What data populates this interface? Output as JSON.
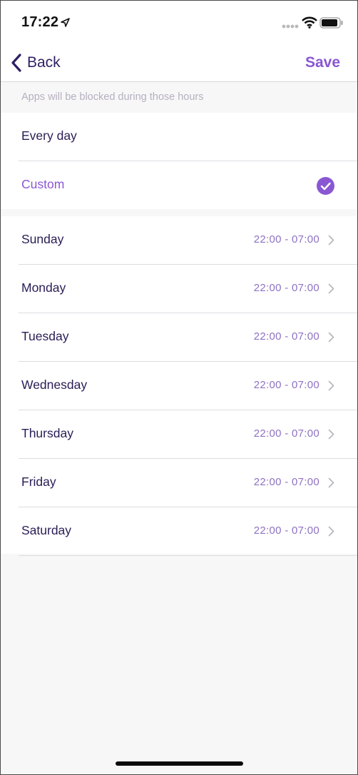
{
  "status_bar": {
    "time": "17:22",
    "icons": [
      "location-arrow-icon",
      "cellular-signal-icon",
      "wifi-icon",
      "battery-icon"
    ]
  },
  "nav": {
    "back_label": "Back",
    "save_label": "Save"
  },
  "hint": "Apps will be blocked during those hours",
  "schedule_modes": [
    {
      "label": "Every day",
      "selected": false
    },
    {
      "label": "Custom",
      "selected": true
    }
  ],
  "days": [
    {
      "day": "Sunday",
      "time": "22:00 - 07:00"
    },
    {
      "day": "Monday",
      "time": "22:00 - 07:00"
    },
    {
      "day": "Tuesday",
      "time": "22:00 - 07:00"
    },
    {
      "day": "Wednesday",
      "time": "22:00 - 07:00"
    },
    {
      "day": "Thursday",
      "time": "22:00 - 07:00"
    },
    {
      "day": "Friday",
      "time": "22:00 - 07:00"
    },
    {
      "day": "Saturday",
      "time": "22:00 - 07:00"
    }
  ],
  "colors": {
    "accent": "#8a57d3",
    "text_primary": "#2a1d55",
    "time_text": "#8e72c2",
    "background": "#f8f7f8"
  }
}
